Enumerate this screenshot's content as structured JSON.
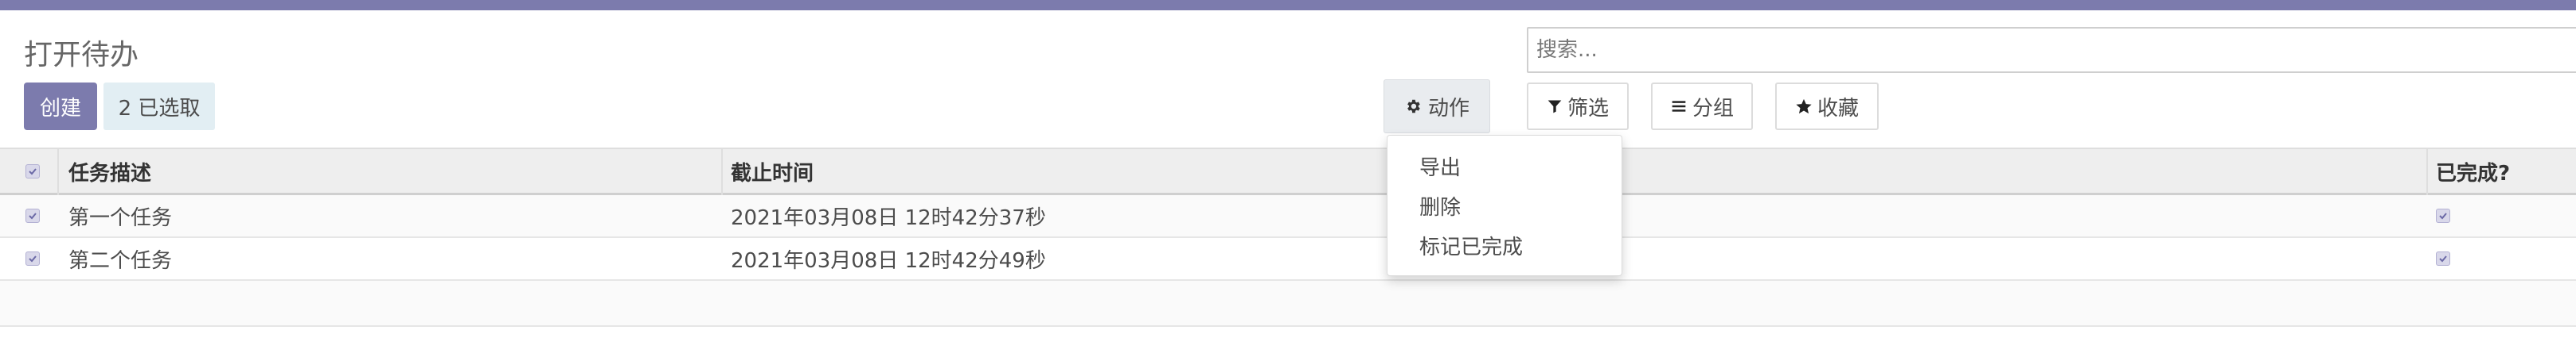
{
  "header": {
    "title": "打开待办",
    "create_label": "创建",
    "selected_label": "2 已选取",
    "action_label": "动作"
  },
  "search": {
    "placeholder": "搜索..."
  },
  "filters": {
    "filter_label": "筛选",
    "group_label": "分组",
    "favorite_label": "收藏"
  },
  "table": {
    "columns": [
      "任务描述",
      "截止时间",
      "已完成?"
    ],
    "rows": [
      {
        "desc": "第一个任务",
        "deadline": "2021年03月08日 12时42分37秒",
        "selected": true,
        "done": true
      },
      {
        "desc": "第二个任务",
        "deadline": "2021年03月08日 12时42分49秒",
        "selected": true,
        "done": true
      }
    ]
  },
  "action_menu": {
    "items": [
      "导出",
      "删除",
      "标记已完成"
    ]
  },
  "icons": {
    "action": "gear-icon",
    "filter": "filter-icon",
    "group": "list-icon",
    "favorite": "star-icon"
  },
  "colors": {
    "brand": "#7c7bad",
    "selected_badge": "#e2eef3",
    "header_bg": "#eeeeee"
  }
}
